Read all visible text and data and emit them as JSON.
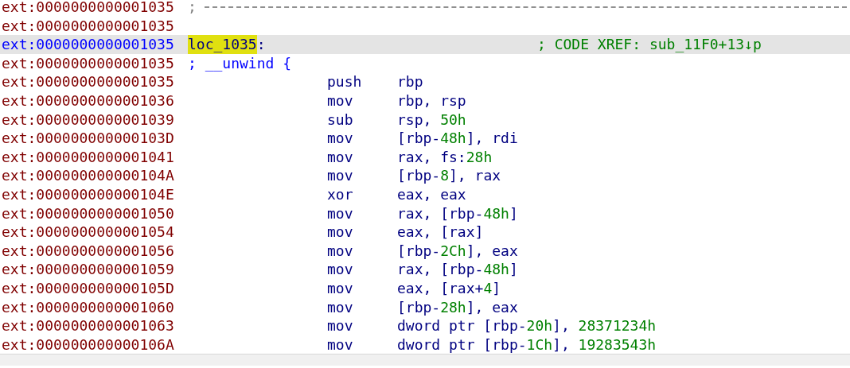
{
  "listing": [
    {
      "kind": "separator",
      "address": "ext:0000000000001035",
      "selected": false,
      "text": ";"
    },
    {
      "kind": "blank",
      "address": "ext:0000000000001035",
      "selected": false
    },
    {
      "kind": "label",
      "address": "ext:0000000000001035",
      "selected": true,
      "label": "loc_1035",
      "highlighted": true,
      "suffix": ":",
      "comment": "; CODE XREF: sub_11F0+13↓p"
    },
    {
      "kind": "comment",
      "address": "ext:0000000000001035",
      "selected": false,
      "text": "; __unwind {"
    },
    {
      "kind": "insn",
      "address": "ext:0000000000001035",
      "selected": false,
      "mnemonic": "push",
      "operands": [
        {
          "kind": "reg",
          "text": "rbp"
        }
      ]
    },
    {
      "kind": "insn",
      "address": "ext:0000000000001036",
      "selected": false,
      "mnemonic": "mov",
      "operands": [
        {
          "kind": "reg",
          "text": "rbp, rsp"
        }
      ]
    },
    {
      "kind": "insn",
      "address": "ext:0000000000001039",
      "selected": false,
      "mnemonic": "sub",
      "operands": [
        {
          "kind": "reg",
          "text": "rsp, "
        },
        {
          "kind": "num",
          "text": "50h"
        }
      ]
    },
    {
      "kind": "insn",
      "address": "ext:000000000000103D",
      "selected": false,
      "mnemonic": "mov",
      "operands": [
        {
          "kind": "reg",
          "text": "[rbp-"
        },
        {
          "kind": "num",
          "text": "48h"
        },
        {
          "kind": "reg",
          "text": "], rdi"
        }
      ]
    },
    {
      "kind": "insn",
      "address": "ext:0000000000001041",
      "selected": false,
      "mnemonic": "mov",
      "operands": [
        {
          "kind": "reg",
          "text": "rax, fs:"
        },
        {
          "kind": "num",
          "text": "28h"
        }
      ]
    },
    {
      "kind": "insn",
      "address": "ext:000000000000104A",
      "selected": false,
      "mnemonic": "mov",
      "operands": [
        {
          "kind": "reg",
          "text": "[rbp-"
        },
        {
          "kind": "num",
          "text": "8"
        },
        {
          "kind": "reg",
          "text": "], rax"
        }
      ]
    },
    {
      "kind": "insn",
      "address": "ext:000000000000104E",
      "selected": false,
      "mnemonic": "xor",
      "operands": [
        {
          "kind": "reg",
          "text": "eax, eax"
        }
      ]
    },
    {
      "kind": "insn",
      "address": "ext:0000000000001050",
      "selected": false,
      "mnemonic": "mov",
      "operands": [
        {
          "kind": "reg",
          "text": "rax, [rbp-"
        },
        {
          "kind": "num",
          "text": "48h"
        },
        {
          "kind": "reg",
          "text": "]"
        }
      ]
    },
    {
      "kind": "insn",
      "address": "ext:0000000000001054",
      "selected": false,
      "mnemonic": "mov",
      "operands": [
        {
          "kind": "reg",
          "text": "eax, [rax]"
        }
      ]
    },
    {
      "kind": "insn",
      "address": "ext:0000000000001056",
      "selected": false,
      "mnemonic": "mov",
      "operands": [
        {
          "kind": "reg",
          "text": "[rbp-"
        },
        {
          "kind": "num",
          "text": "2Ch"
        },
        {
          "kind": "reg",
          "text": "], eax"
        }
      ]
    },
    {
      "kind": "insn",
      "address": "ext:0000000000001059",
      "selected": false,
      "mnemonic": "mov",
      "operands": [
        {
          "kind": "reg",
          "text": "rax, [rbp-"
        },
        {
          "kind": "num",
          "text": "48h"
        },
        {
          "kind": "reg",
          "text": "]"
        }
      ]
    },
    {
      "kind": "insn",
      "address": "ext:000000000000105D",
      "selected": false,
      "mnemonic": "mov",
      "operands": [
        {
          "kind": "reg",
          "text": "eax, [rax+"
        },
        {
          "kind": "num",
          "text": "4"
        },
        {
          "kind": "reg",
          "text": "]"
        }
      ]
    },
    {
      "kind": "insn",
      "address": "ext:0000000000001060",
      "selected": false,
      "mnemonic": "mov",
      "operands": [
        {
          "kind": "reg",
          "text": "[rbp-"
        },
        {
          "kind": "num",
          "text": "28h"
        },
        {
          "kind": "reg",
          "text": "], eax"
        }
      ]
    },
    {
      "kind": "insn",
      "address": "ext:0000000000001063",
      "selected": false,
      "mnemonic": "mov",
      "operands": [
        {
          "kind": "reg",
          "text": "dword ptr [rbp-"
        },
        {
          "kind": "num",
          "text": "20h"
        },
        {
          "kind": "reg",
          "text": "], "
        },
        {
          "kind": "num",
          "text": "28371234h"
        }
      ]
    },
    {
      "kind": "insn",
      "address": "ext:000000000000106A",
      "selected": false,
      "mnemonic": "mov",
      "operands": [
        {
          "kind": "reg",
          "text": "dword ptr [rbp-"
        },
        {
          "kind": "num",
          "text": "1Ch"
        },
        {
          "kind": "reg",
          "text": "], "
        },
        {
          "kind": "num",
          "text": "19283543h"
        }
      ]
    }
  ]
}
